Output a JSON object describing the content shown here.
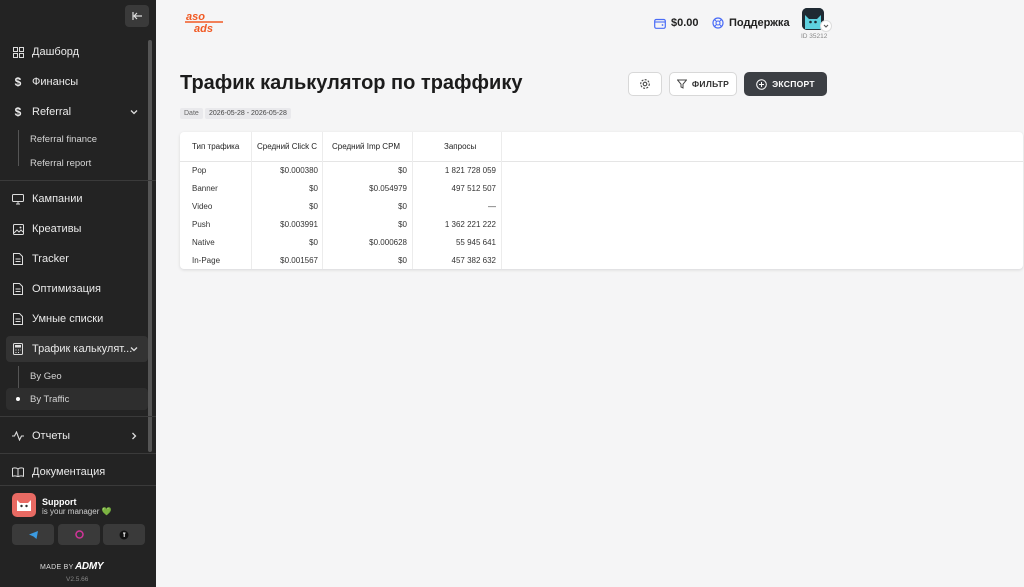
{
  "sidebar": {
    "items": [
      {
        "label": "Дашборд",
        "icon": "grid-icon"
      },
      {
        "label": "Финансы",
        "icon": "dollar-icon"
      },
      {
        "label": "Referral",
        "icon": "dollar-icon"
      },
      {
        "label": "Кампании",
        "icon": "monitor-icon"
      },
      {
        "label": "Креативы",
        "icon": "image-icon"
      },
      {
        "label": "Tracker",
        "icon": "document-icon"
      },
      {
        "label": "Оптимизация",
        "icon": "document-icon"
      },
      {
        "label": "Умные списки",
        "icon": "document-icon"
      },
      {
        "label": "Трафик калькулят...",
        "icon": "calculator-icon"
      },
      {
        "label": "Отчеты",
        "icon": "activity-icon"
      },
      {
        "label": "Документация",
        "icon": "book-icon"
      }
    ],
    "referral_sub": [
      "Referral finance",
      "Referral report"
    ],
    "traffic_sub": [
      "By Geo",
      "By Traffic"
    ],
    "support": {
      "title": "Support",
      "subtitle": "is your manager 💚"
    },
    "made_by": "MADE BY",
    "made_by_brand": "ADMY",
    "version": "V2.5.66"
  },
  "topbar": {
    "brand_line1": "aso",
    "brand_line2": "ads",
    "balance": "$0.00",
    "support_label": "Поддержка",
    "user_id": "ID 35212"
  },
  "header": {
    "title": "Трафик калькулятор по траффику",
    "date_label": "Date",
    "date_range": "2026-05-28 - 2026-05-28",
    "filter_label": "ФИЛЬТР",
    "export_label": "ЭКСПОРТ"
  },
  "table": {
    "columns": [
      "Тип трафика",
      "Средний Click C",
      "Средний Imp CPM",
      "Запросы"
    ],
    "rows": [
      [
        "Pop",
        "$0.000380",
        "$0",
        "1 821 728 059"
      ],
      [
        "Banner",
        "$0",
        "$0.054979",
        "497 512 507"
      ],
      [
        "Video",
        "$0",
        "$0",
        "—"
      ],
      [
        "Push",
        "$0.003991",
        "$0",
        "1 362 221 222"
      ],
      [
        "Native",
        "$0",
        "$0.000628",
        "55 945 641"
      ],
      [
        "In-Page",
        "$0.001567",
        "$0",
        "457 382 632"
      ]
    ]
  },
  "colors": {
    "sidebar_bg": "#232323",
    "brand_accent": "#f15a24",
    "export_bg": "#3c3f44"
  }
}
